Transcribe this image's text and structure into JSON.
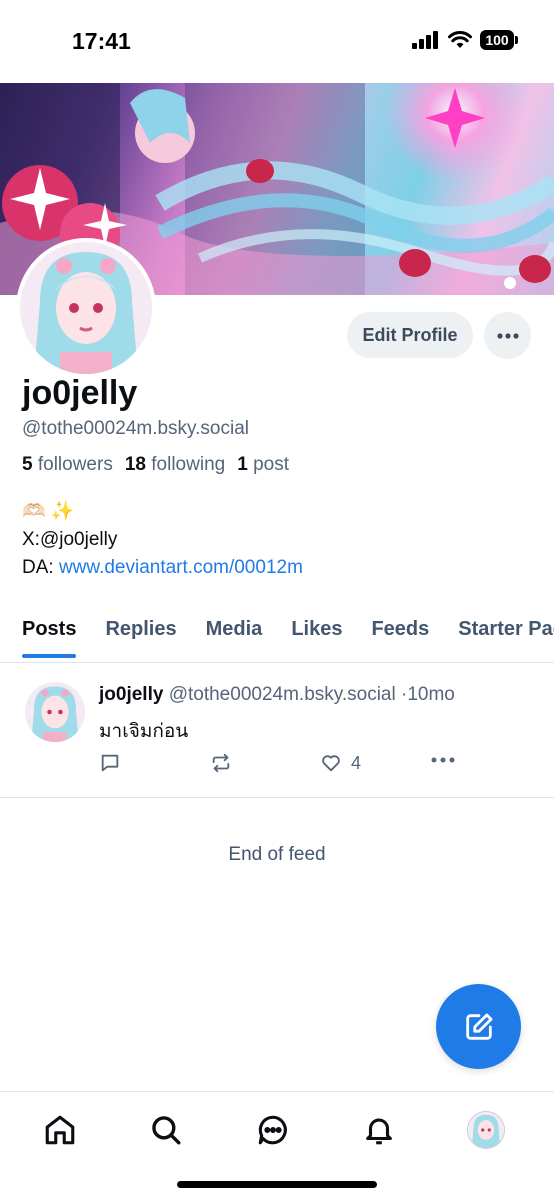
{
  "status_bar": {
    "time": "17:41",
    "battery": "100"
  },
  "profile": {
    "display_name": "jo0jelly",
    "handle": "@tothe00024m.bsky.social",
    "followers_count": "5",
    "followers_label": "followers",
    "following_count": "18",
    "following_label": "following",
    "posts_count": "1",
    "posts_label": "post",
    "edit_button_label": "Edit Profile",
    "bio_emojis": "🫶🏻 ✨",
    "bio_line2": "X:@jo0jelly",
    "bio_line3_prefix": "DA: ",
    "bio_link": "www.deviantart.com/00012m"
  },
  "tabs": [
    {
      "label": "Posts",
      "active": true
    },
    {
      "label": "Replies"
    },
    {
      "label": "Media"
    },
    {
      "label": "Likes"
    },
    {
      "label": "Feeds"
    },
    {
      "label": "Starter Packs"
    }
  ],
  "post": {
    "author_name": "jo0jelly",
    "author_handle": "@tothe00024m.bsky.social",
    "separator": "·",
    "time_ago": "10mo",
    "text": "มาเจิมก่อน",
    "like_count": "4"
  },
  "feed_end_text": "End of feed",
  "icons": {
    "reply": "reply-icon",
    "repost": "repost-icon",
    "like": "heart-icon",
    "more": "more-icon",
    "compose": "compose-icon",
    "home": "home-icon",
    "search": "search-icon",
    "chat": "chat-icon",
    "notifications": "bell-icon"
  },
  "colors": {
    "accent": "#1f7be8",
    "muted": "#566579"
  }
}
